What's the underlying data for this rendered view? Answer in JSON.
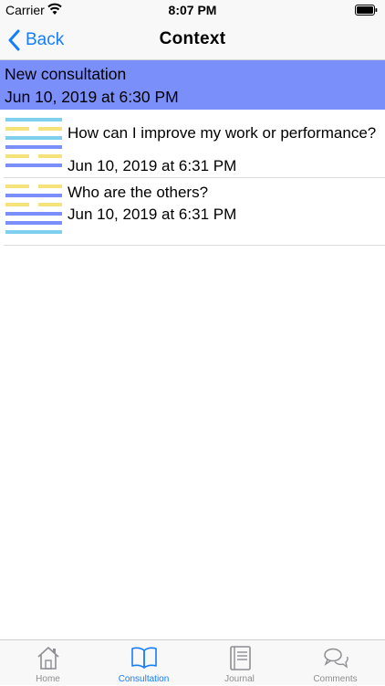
{
  "status_bar": {
    "carrier": "Carrier",
    "time": "8:07 PM"
  },
  "nav": {
    "back_label": "Back",
    "title": "Context"
  },
  "new_consultation": {
    "title": "New consultation",
    "date": "Jun 10, 2019 at 6:30 PM"
  },
  "consultations": [
    {
      "question": "How can I improve my work or performance?",
      "date": "Jun 10, 2019 at 6:31 PM",
      "icon": "hexagram-icon"
    },
    {
      "question": "Who are the others?",
      "date": "Jun 10, 2019 at 6:31 PM",
      "icon": "hexagram-icon"
    }
  ],
  "tabs": [
    {
      "label": "Home",
      "icon": "home-icon"
    },
    {
      "label": "Consultation",
      "icon": "book-icon",
      "active": true
    },
    {
      "label": "Journal",
      "icon": "journal-icon"
    },
    {
      "label": "Comments",
      "icon": "comments-icon"
    }
  ],
  "colors": {
    "accent": "#157efb",
    "highlight": "#7b8ffb",
    "hex_blue": "#7b8ffb",
    "hex_cyan": "#7fcfee",
    "hex_yellow": "#f6e27a"
  }
}
